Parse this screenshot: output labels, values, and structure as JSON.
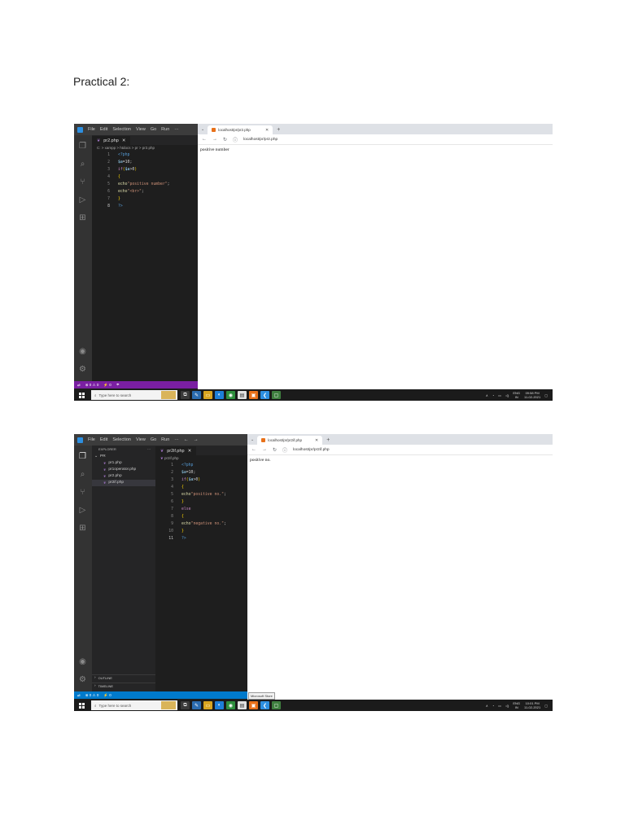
{
  "doc": {
    "title": "Practical 2:"
  },
  "vscode_menu": [
    "File",
    "Edit",
    "Selection",
    "View",
    "Go",
    "Run",
    "···"
  ],
  "shot1": {
    "editor_tab": "pr2.php",
    "tab_close": "✕",
    "breadcrumb": "C: > xampp > htdocs > pr > pr2.php",
    "code": [
      {
        "n": "1",
        "toks": [
          {
            "c": "tk-tag",
            "t": "<?php"
          }
        ]
      },
      {
        "n": "2",
        "toks": [
          {
            "c": "tk-var",
            "t": "$a"
          },
          {
            "c": "tk-plain",
            "t": "=10;"
          }
        ]
      },
      {
        "n": "3",
        "toks": [
          {
            "c": "tk-kw",
            "t": "if"
          },
          {
            "c": "tk-br",
            "t": "("
          },
          {
            "c": "tk-var",
            "t": "$a"
          },
          {
            "c": "tk-plain",
            "t": ">0"
          },
          {
            "c": "tk-br",
            "t": ")"
          }
        ]
      },
      {
        "n": "4",
        "toks": [
          {
            "c": "tk-br",
            "t": "{"
          }
        ]
      },
      {
        "n": "5",
        "toks": [
          {
            "c": "tk-fn",
            "t": "echo"
          },
          {
            "c": "tk-str",
            "t": "\"positive number\""
          },
          {
            "c": "tk-plain",
            "t": ";"
          }
        ]
      },
      {
        "n": "6",
        "toks": [
          {
            "c": "tk-fn",
            "t": "echo"
          },
          {
            "c": "tk-str",
            "t": "\"<br>\""
          },
          {
            "c": "tk-plain",
            "t": ";"
          }
        ]
      },
      {
        "n": "7",
        "toks": [
          {
            "c": "tk-br",
            "t": "}"
          }
        ]
      },
      {
        "n": "8",
        "toks": [
          {
            "c": "tk-tag",
            "t": "?>"
          }
        ],
        "current": true
      }
    ],
    "status": [
      "⊗ 0 ⚠ 0",
      "⚡ 0",
      "☂"
    ],
    "browser_tab": "localhost/pr/pr2.php",
    "url": "localhost/pr/pr2.php",
    "output": "positive number"
  },
  "shot2": {
    "editor_tab": "pr2if.php",
    "tab_close": "✕",
    "breadcrumb": "pr2if.php",
    "explorer_title": "EXPLORER",
    "explorer_more": "···",
    "folder": "PR",
    "files": [
      "pr1.php",
      "pr1operator.php",
      "pr2.php",
      "pr2if.php"
    ],
    "outline": "OUTLINE",
    "timeline": "TIMELINE",
    "code": [
      {
        "n": "1",
        "toks": [
          {
            "c": "tk-tag",
            "t": "<?php"
          }
        ]
      },
      {
        "n": "2",
        "toks": [
          {
            "c": "tk-var",
            "t": "$a"
          },
          {
            "c": "tk-plain",
            "t": "=10;"
          }
        ]
      },
      {
        "n": "3",
        "toks": [
          {
            "c": "tk-kw",
            "t": "if"
          },
          {
            "c": "tk-br",
            "t": "("
          },
          {
            "c": "tk-var",
            "t": "$a"
          },
          {
            "c": "tk-plain",
            "t": ">0"
          },
          {
            "c": "tk-br",
            "t": ")"
          }
        ]
      },
      {
        "n": "4",
        "toks": [
          {
            "c": "tk-br",
            "t": "{"
          }
        ]
      },
      {
        "n": "5",
        "toks": [
          {
            "c": "tk-fn",
            "t": "echo"
          },
          {
            "c": "tk-str",
            "t": "\"positive no.\""
          },
          {
            "c": "tk-plain",
            "t": ";"
          }
        ]
      },
      {
        "n": "6",
        "toks": [
          {
            "c": "tk-br",
            "t": "}"
          }
        ]
      },
      {
        "n": "7",
        "toks": [
          {
            "c": "tk-kw",
            "t": "else"
          }
        ]
      },
      {
        "n": "8",
        "toks": [
          {
            "c": "tk-br",
            "t": "{"
          }
        ]
      },
      {
        "n": "9",
        "toks": [
          {
            "c": "tk-fn",
            "t": "echo"
          },
          {
            "c": "tk-str",
            "t": "\"negative no.\""
          },
          {
            "c": "tk-plain",
            "t": ";"
          }
        ]
      },
      {
        "n": "10",
        "toks": [
          {
            "c": "tk-br",
            "t": "}"
          }
        ]
      },
      {
        "n": "11",
        "toks": [
          {
            "c": "tk-tag",
            "t": "?>"
          }
        ],
        "current": true
      }
    ],
    "status": [
      "⊗ 0 ⚠ 0",
      "⚡ 0"
    ],
    "browser_tab": "localhost/pr/pr2if.php",
    "url": "localhost/pr/pr2if.php",
    "output": "positive no.",
    "tooltip": "Microsoft Store"
  },
  "taskbar": {
    "search_placeholder": "Type here to search",
    "tray_lang": "ENG\nIN",
    "time1": "09:58 PM",
    "date1": "11-02-2021",
    "time2": "10:01 PM",
    "date2": "11-02-2021"
  },
  "colors": {
    "statusbar1": "#7a1fa2",
    "statusbar2": "#007acc",
    "accent": "#2d8fe0"
  }
}
